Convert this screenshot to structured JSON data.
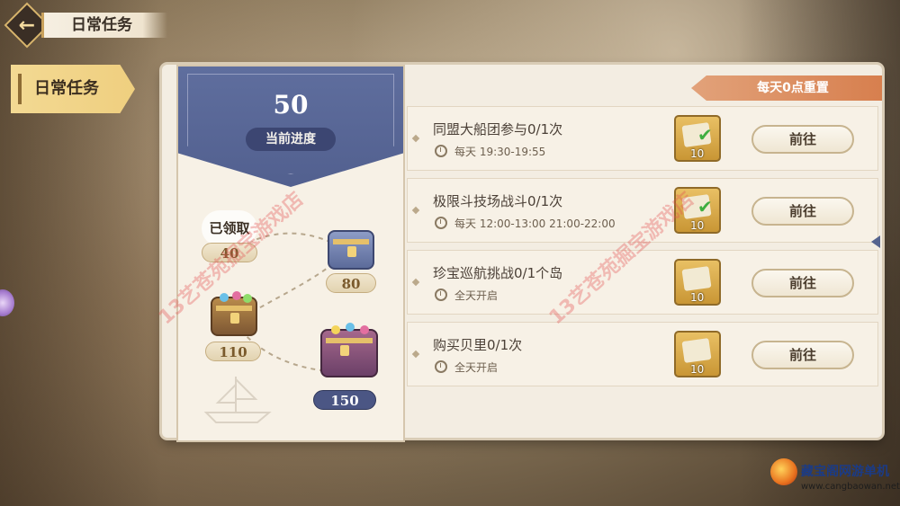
{
  "header": {
    "back_glyph": "←",
    "title": "日常任务"
  },
  "sidebar": {
    "active_tab": "日常任务"
  },
  "progress": {
    "value": "50",
    "label": "当前进度",
    "claimed_label": "已领取",
    "milestones": [
      {
        "value": "40",
        "status": "claimed",
        "chest": "none"
      },
      {
        "value": "80",
        "status": "locked",
        "chest": "blue-chest"
      },
      {
        "value": "110",
        "status": "locked",
        "chest": "gold-chest"
      },
      {
        "value": "150",
        "status": "locked",
        "chest": "big-chest"
      }
    ]
  },
  "reset_notice": "每天0点重置",
  "tasks": [
    {
      "title": "同盟大船团参与0/1次",
      "time": "每天  19:30-19:55",
      "reward_qty": "10",
      "button": "前往"
    },
    {
      "title": "极限斗技场战斗0/1次",
      "time": "每天  12:00-13:00  21:00-22:00",
      "reward_qty": "10",
      "button": "前往"
    },
    {
      "title": "珍宝巡航挑战0/1个岛",
      "time": "全天开启",
      "reward_qty": "10",
      "button": "前往"
    },
    {
      "title": "购买贝里0/1次",
      "time": "全天开启",
      "reward_qty": "10",
      "button": "前往"
    }
  ],
  "watermarks": [
    "13艺苍苑掘宝游戏店",
    "13艺苍苑掘宝游戏店"
  ],
  "corner_logo": {
    "name": "藏宝阁网游单机",
    "url": "www.cangbaowan.net"
  },
  "colors": {
    "accent_blue": "#52608f",
    "reset_orange": "#d77f4e",
    "reward_gold": "#c99635"
  }
}
